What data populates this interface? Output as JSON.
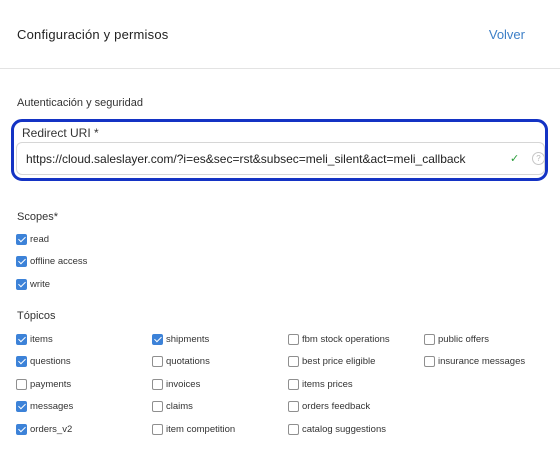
{
  "header": {
    "title": "Configuración y permisos",
    "back_label": "Volver"
  },
  "auth": {
    "section_title": "Autenticación y seguridad",
    "redirect_label": "Redirect URI *",
    "redirect_value": "https://cloud.saleslayer.com/?i=es&sec=rst&subsec=meli_silent&act=meli_callback",
    "check_glyph": "✓",
    "help_glyph": "?"
  },
  "scopes": {
    "title": "Scopes*",
    "items": [
      {
        "label": "read",
        "checked": true
      },
      {
        "label": "offline access",
        "checked": true
      },
      {
        "label": "write",
        "checked": true
      }
    ]
  },
  "topics": {
    "title": "Tópicos",
    "columns": [
      [
        {
          "label": "items",
          "checked": true
        },
        {
          "label": "questions",
          "checked": true
        },
        {
          "label": "payments",
          "checked": false
        },
        {
          "label": "messages",
          "checked": true
        },
        {
          "label": "orders_v2",
          "checked": true
        }
      ],
      [
        {
          "label": "shipments",
          "checked": true
        },
        {
          "label": "quotations",
          "checked": false
        },
        {
          "label": "invoices",
          "checked": false
        },
        {
          "label": "claims",
          "checked": false
        },
        {
          "label": "item competition",
          "checked": false
        }
      ],
      [
        {
          "label": "fbm stock operations",
          "checked": false
        },
        {
          "label": "best price eligible",
          "checked": false
        },
        {
          "label": "items prices",
          "checked": false
        },
        {
          "label": "orders feedback",
          "checked": false
        },
        {
          "label": "catalog suggestions",
          "checked": false
        }
      ],
      [
        {
          "label": "public offers",
          "checked": false
        },
        {
          "label": "insurance messages",
          "checked": false
        }
      ]
    ]
  },
  "colors": {
    "accent": "#3c82d8",
    "highlight": "#1433c4",
    "link": "#3d7fc7",
    "valid": "#2a9d3a"
  }
}
